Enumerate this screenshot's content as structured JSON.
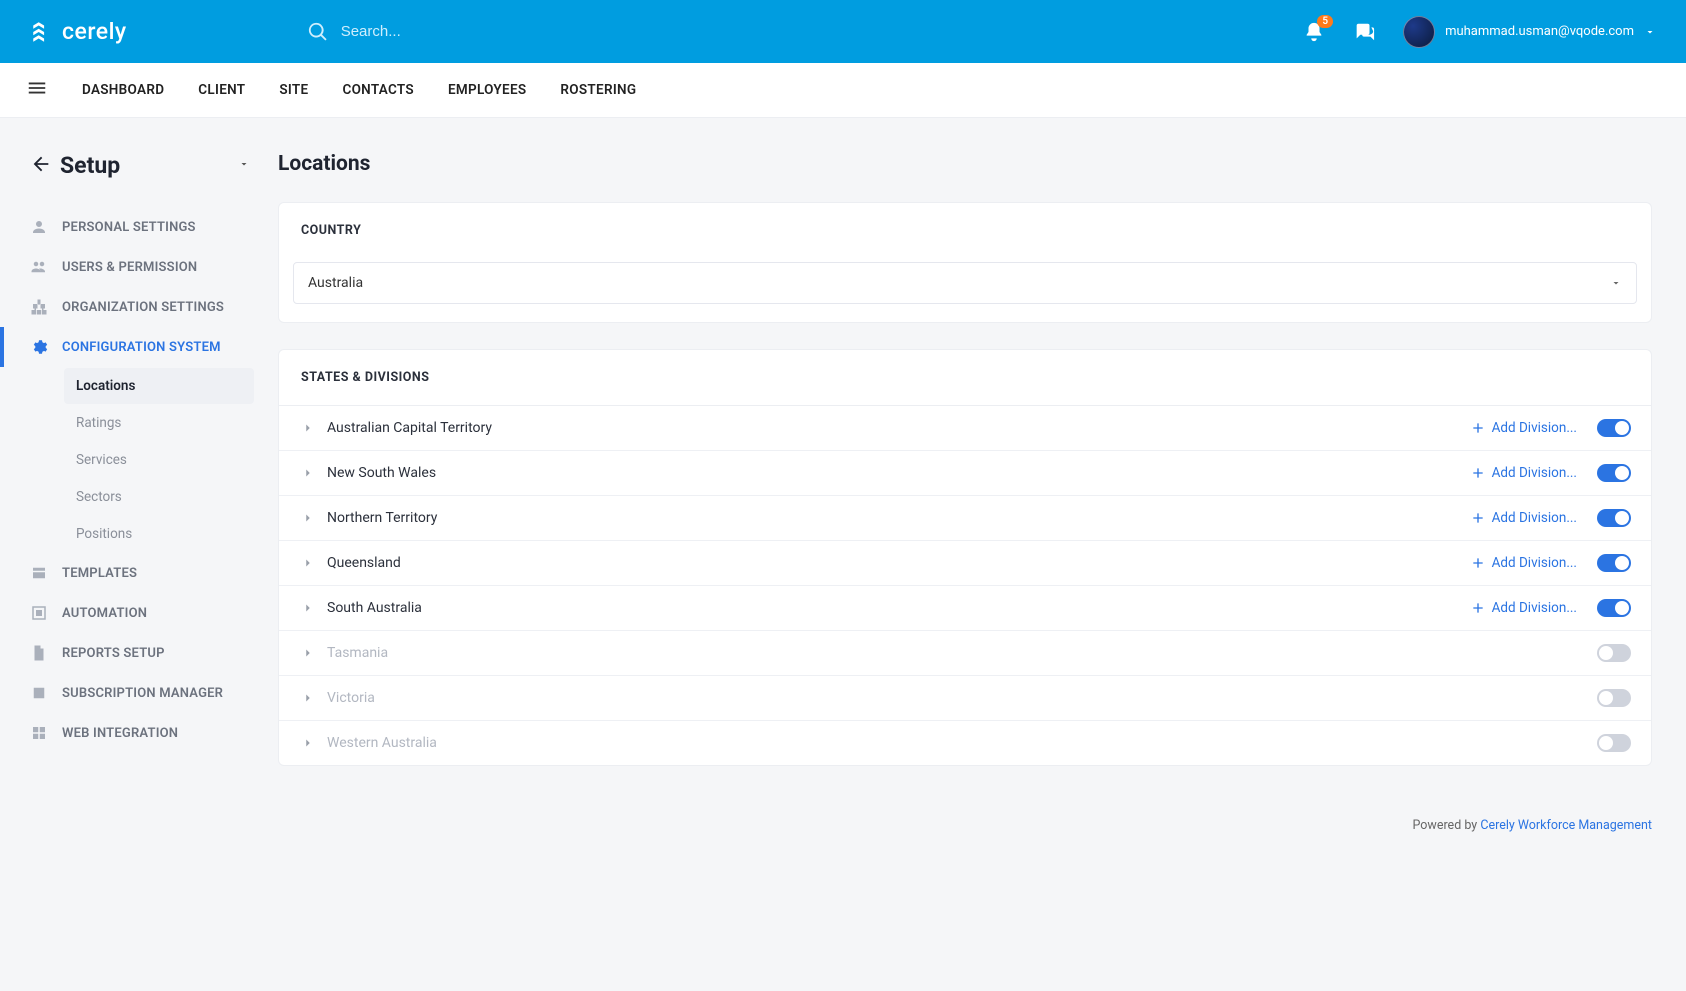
{
  "brand": {
    "name": "cerely"
  },
  "search": {
    "placeholder": "Search..."
  },
  "notifications": {
    "count": "5"
  },
  "user": {
    "email": "muhammad.usman@vqode.com"
  },
  "nav": {
    "items": [
      "DASHBOARD",
      "CLIENT",
      "SITE",
      "CONTACTS",
      "EMPLOYEES",
      "ROSTERING"
    ]
  },
  "setup": {
    "title": "Setup"
  },
  "sidebar": {
    "items": [
      {
        "label": "PERSONAL SETTINGS"
      },
      {
        "label": "USERS & PERMISSION"
      },
      {
        "label": "ORGANIZATION SETTINGS"
      },
      {
        "label": "CONFIGURATION SYSTEM"
      },
      {
        "label": "TEMPLATES"
      },
      {
        "label": "AUTOMATION"
      },
      {
        "label": "REPORTS SETUP"
      },
      {
        "label": "SUBSCRIPTION MANAGER"
      },
      {
        "label": "WEB INTEGRATION"
      }
    ],
    "config_sub": [
      {
        "label": "Locations"
      },
      {
        "label": "Ratings"
      },
      {
        "label": "Services"
      },
      {
        "label": "Sectors"
      },
      {
        "label": "Positions"
      }
    ]
  },
  "page": {
    "title": "Locations"
  },
  "country": {
    "label": "COUNTRY",
    "value": "Australia"
  },
  "states": {
    "label": "STATES & DIVISIONS",
    "add_label": "Add Division...",
    "rows": [
      {
        "name": "Australian Capital Territory",
        "enabled": true
      },
      {
        "name": "New South Wales",
        "enabled": true
      },
      {
        "name": "Northern Territory",
        "enabled": true
      },
      {
        "name": "Queensland",
        "enabled": true
      },
      {
        "name": "South Australia",
        "enabled": true
      },
      {
        "name": "Tasmania",
        "enabled": false
      },
      {
        "name": "Victoria",
        "enabled": false
      },
      {
        "name": "Western Australia",
        "enabled": false
      }
    ]
  },
  "footer": {
    "prefix": "Powered by ",
    "link": "Cerely Workforce Management"
  }
}
